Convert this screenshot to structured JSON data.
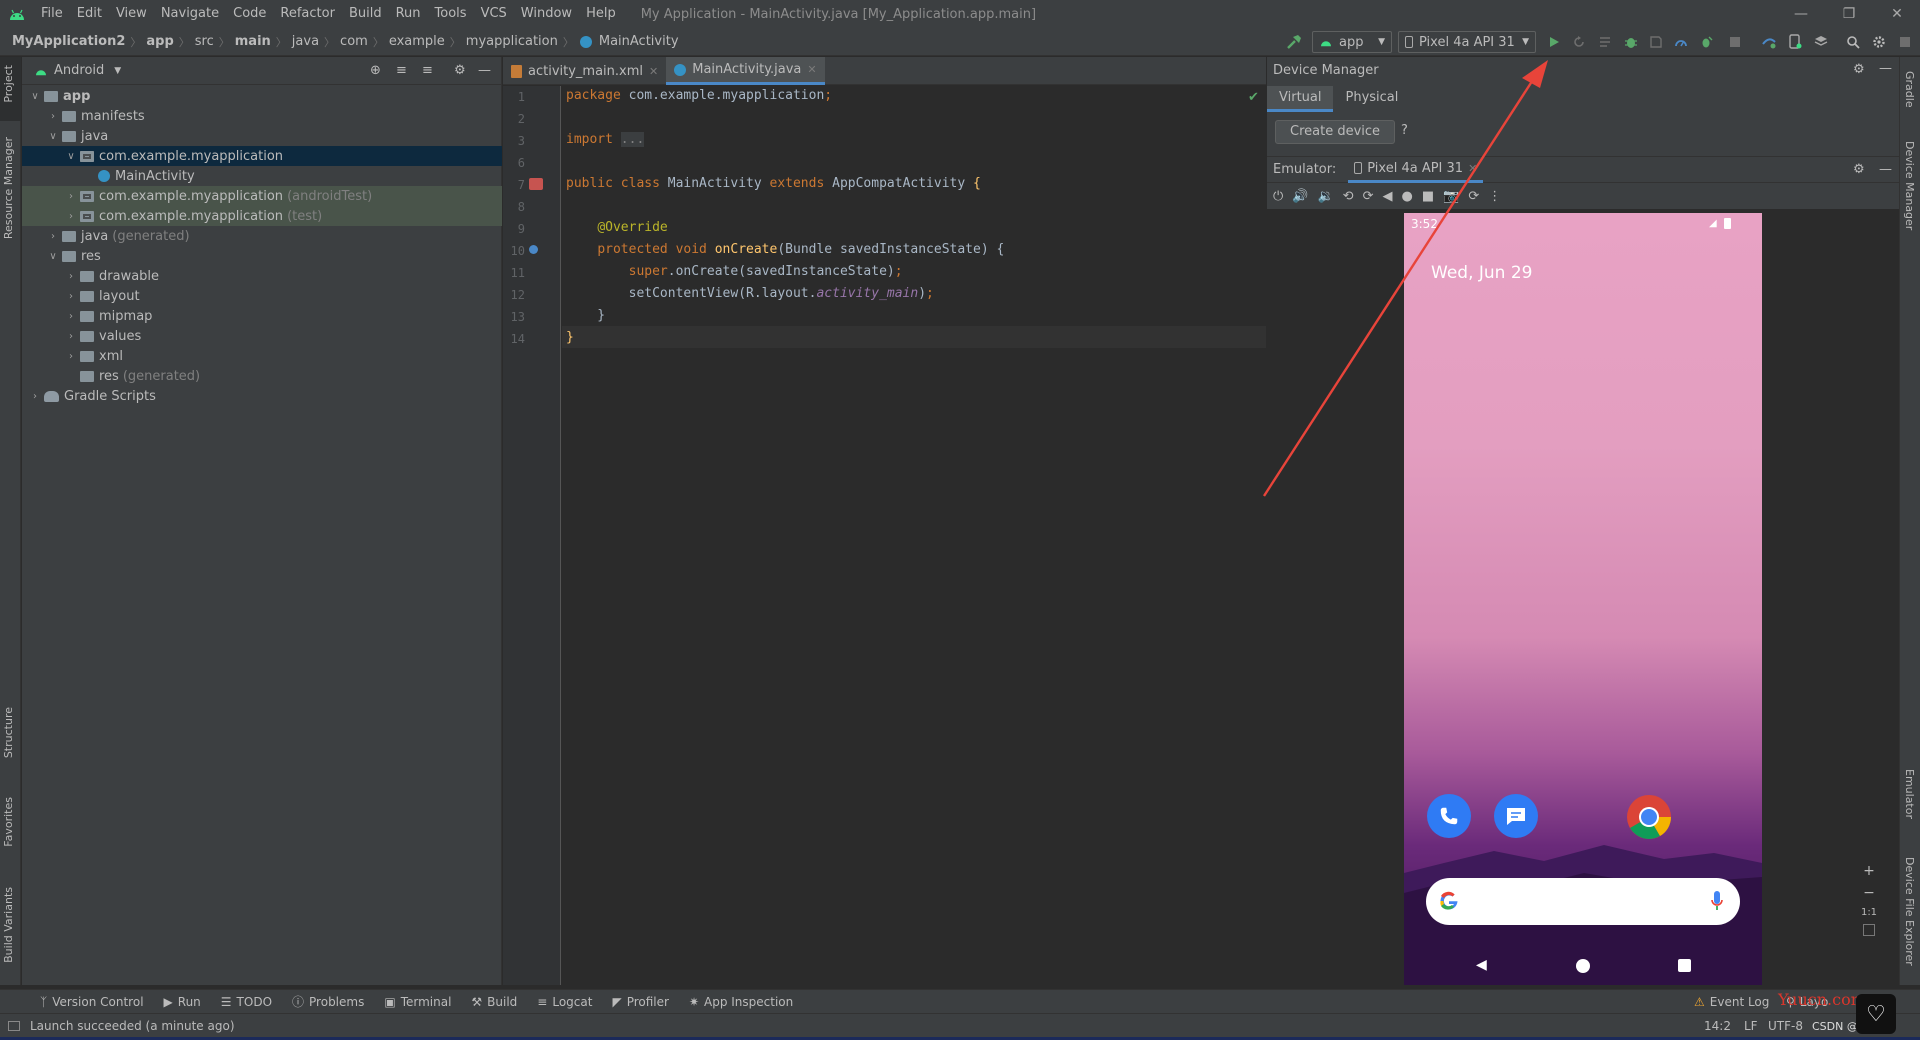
{
  "window": {
    "menu": [
      "File",
      "Edit",
      "View",
      "Navigate",
      "Code",
      "Refactor",
      "Build",
      "Run",
      "Tools",
      "VCS",
      "Window",
      "Help"
    ],
    "title": "My Application - MainActivity.java [My_Application.app.main]"
  },
  "breadcrumb": [
    "MyApplication2",
    "app",
    "src",
    "main",
    "java",
    "com",
    "example",
    "myapplication",
    "MainActivity"
  ],
  "toolbar": {
    "run_config": "app",
    "device": "Pixel 4a API 31"
  },
  "project_panel": {
    "view_mode": "Android",
    "tree": [
      {
        "label": "app",
        "depth": 0,
        "icon": "folder",
        "bold": true,
        "expanded": true
      },
      {
        "label": "manifests",
        "depth": 1,
        "icon": "folder",
        "expanded": false
      },
      {
        "label": "java",
        "depth": 1,
        "icon": "folder",
        "expanded": true
      },
      {
        "label": "com.example.myapplication",
        "depth": 2,
        "icon": "package",
        "expanded": true,
        "selected": true
      },
      {
        "label": "MainActivity",
        "depth": 3,
        "icon": "class"
      },
      {
        "label": "com.example.myapplication",
        "suffix": "(androidTest)",
        "depth": 2,
        "icon": "package",
        "expanded": false,
        "test": true
      },
      {
        "label": "com.example.myapplication",
        "suffix": "(test)",
        "depth": 2,
        "icon": "package",
        "expanded": false,
        "test": true
      },
      {
        "label": "java",
        "suffix": "(generated)",
        "depth": 1,
        "icon": "folder",
        "expanded": false
      },
      {
        "label": "res",
        "depth": 1,
        "icon": "folder",
        "expanded": true
      },
      {
        "label": "drawable",
        "depth": 2,
        "icon": "folder",
        "expanded": false
      },
      {
        "label": "layout",
        "depth": 2,
        "icon": "folder",
        "expanded": false
      },
      {
        "label": "mipmap",
        "depth": 2,
        "icon": "folder",
        "expanded": false
      },
      {
        "label": "values",
        "depth": 2,
        "icon": "folder",
        "expanded": false
      },
      {
        "label": "xml",
        "depth": 2,
        "icon": "folder",
        "expanded": false
      },
      {
        "label": "res",
        "suffix": "(generated)",
        "depth": 2,
        "icon": "folder",
        "leaf": true
      },
      {
        "label": "Gradle Scripts",
        "depth": 0,
        "icon": "gradle",
        "expanded": false
      }
    ]
  },
  "left_stripe": [
    "Project",
    "Resource Manager",
    "Structure",
    "Favorites",
    "Build Variants"
  ],
  "right_stripe": [
    "Gradle",
    "Device Manager",
    "Emulator",
    "Device File Explorer"
  ],
  "editor": {
    "tabs": [
      {
        "label": "activity_main.xml",
        "active": false
      },
      {
        "label": "MainActivity.java",
        "active": true
      }
    ],
    "line_numbers": [
      "1",
      "2",
      "3",
      "6",
      "7",
      "8",
      "9",
      "10",
      "11",
      "12",
      "13",
      "14"
    ],
    "lines": [
      [
        {
          "t": "package ",
          "c": "kw"
        },
        {
          "t": "com.example.myapplication",
          "c": ""
        },
        {
          "t": ";",
          "c": "kw"
        }
      ],
      [],
      [
        {
          "t": "import ",
          "c": "kw"
        },
        {
          "t": "...",
          "c": "fold"
        }
      ],
      [],
      [
        {
          "t": "public class ",
          "c": "kw"
        },
        {
          "t": "MainActivity ",
          "c": ""
        },
        {
          "t": "extends ",
          "c": "kw"
        },
        {
          "t": "AppCompatActivity ",
          "c": ""
        },
        {
          "t": "{",
          "c": "fn"
        }
      ],
      [],
      [
        {
          "t": "    ",
          "c": ""
        },
        {
          "t": "@Override",
          "c": "ann"
        }
      ],
      [
        {
          "t": "    ",
          "c": ""
        },
        {
          "t": "protected void ",
          "c": "kw"
        },
        {
          "t": "onCreate",
          "c": "fn"
        },
        {
          "t": "(Bundle savedInstanceState) {",
          "c": ""
        }
      ],
      [
        {
          "t": "        ",
          "c": ""
        },
        {
          "t": "super",
          "c": "kw"
        },
        {
          "t": ".onCreate(savedInstanceState)",
          "c": ""
        },
        {
          "t": ";",
          "c": "kw"
        }
      ],
      [
        {
          "t": "        ",
          "c": ""
        },
        {
          "t": "setContentView(R.layout.",
          "c": ""
        },
        {
          "t": "activity_main",
          "c": "it"
        },
        {
          "t": ")",
          "c": ""
        },
        {
          "t": ";",
          "c": "kw"
        }
      ],
      [
        {
          "t": "    }",
          "c": ""
        }
      ],
      [
        {
          "t": "}",
          "c": "fn"
        }
      ]
    ]
  },
  "device_manager": {
    "title": "Device Manager",
    "tabs": [
      "Virtual",
      "Physical"
    ],
    "create_label": "Create device",
    "help_label": "?"
  },
  "emulator": {
    "label": "Emulator:",
    "tab": "Pixel 4a API 31",
    "phone": {
      "time": "3:52",
      "date": "Wed, Jun 29"
    },
    "zoom_plus": "+",
    "zoom_minus": "−",
    "zoom_reset": "1:1"
  },
  "bottom_tools": [
    "Version Control",
    "Run",
    "TODO",
    "Problems",
    "Terminal",
    "Build",
    "Logcat",
    "Profiler",
    "App Inspection"
  ],
  "bottom_right": [
    "Event Log",
    "Layo"
  ],
  "status": {
    "message": "Launch succeeded (a minute ago)",
    "position": "14:2",
    "line_sep": "LF",
    "encoding": "UTF-8"
  },
  "watermarks": {
    "yuucn": "Yuucn.com",
    "csdn": "CSDN @小猪之"
  },
  "colors": {
    "accent": "#4a88c7",
    "run_green": "#59a869",
    "annotation_arrow": "#e8443a"
  }
}
